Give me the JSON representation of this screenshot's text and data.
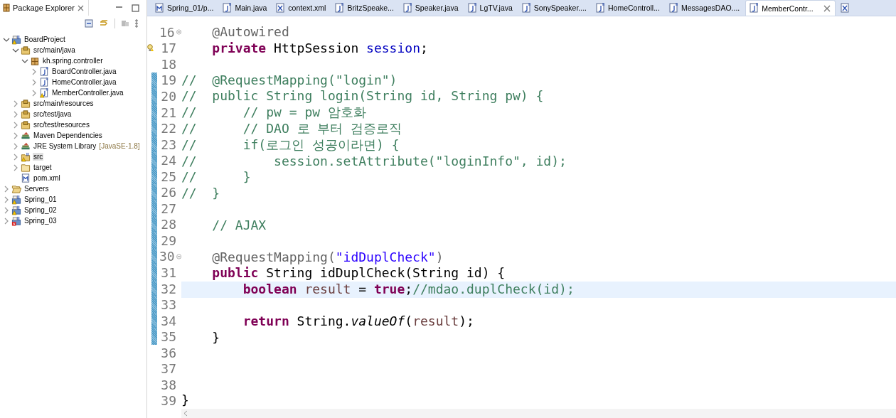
{
  "explorer": {
    "title": "Package Explorer",
    "tree": [
      {
        "label": "BoardProject",
        "kind": "project",
        "warning": true,
        "expanded": true,
        "selected": false,
        "children": [
          {
            "label": "src/main/java",
            "kind": "source-folder",
            "expanded": true,
            "selected": false,
            "children": [
              {
                "label": "kh.spring.controller",
                "kind": "package",
                "expanded": true,
                "selected": false,
                "children": [
                  {
                    "label": "BoardController.java",
                    "kind": "java",
                    "expanded": false,
                    "selected": false
                  },
                  {
                    "label": "HomeController.java",
                    "kind": "java",
                    "expanded": false,
                    "selected": false
                  },
                  {
                    "label": "MemberController.java",
                    "kind": "java",
                    "warning": true,
                    "expanded": false,
                    "selected": false
                  }
                ]
              }
            ]
          },
          {
            "label": "src/main/resources",
            "kind": "source-folder",
            "expanded": false,
            "selected": false
          },
          {
            "label": "src/test/java",
            "kind": "source-folder",
            "expanded": false,
            "selected": false
          },
          {
            "label": "src/test/resources",
            "kind": "source-folder",
            "expanded": false,
            "selected": false
          },
          {
            "label": "Maven Dependencies",
            "kind": "library",
            "expanded": false,
            "selected": false
          },
          {
            "label": "JRE System Library",
            "decoration": "[JavaSE-1.8]",
            "kind": "library",
            "expanded": false,
            "selected": false
          },
          {
            "label": "src",
            "kind": "folder-project",
            "warning": true,
            "expanded": false,
            "selected": true
          },
          {
            "label": "target",
            "kind": "folder",
            "expanded": false,
            "selected": false
          },
          {
            "label": "pom.xml",
            "kind": "maven",
            "selected": false
          }
        ]
      },
      {
        "label": "Servers",
        "kind": "folder-open",
        "expanded": false,
        "selected": false
      },
      {
        "label": "Spring_01",
        "kind": "project",
        "warning": true,
        "expanded": false,
        "selected": false
      },
      {
        "label": "Spring_02",
        "kind": "project",
        "warning": true,
        "expanded": false,
        "selected": false
      },
      {
        "label": "Spring_03",
        "kind": "project",
        "error": true,
        "expanded": false,
        "selected": false
      }
    ]
  },
  "editor": {
    "tabs": [
      {
        "label": "Spring_01/p...",
        "kind": "maven",
        "selected": false
      },
      {
        "label": "Main.java",
        "kind": "java",
        "selected": false
      },
      {
        "label": "context.xml",
        "kind": "xml",
        "selected": false
      },
      {
        "label": "BritzSpeake...",
        "kind": "java",
        "selected": false
      },
      {
        "label": "Speaker.java",
        "kind": "java",
        "selected": false
      },
      {
        "label": "LgTV.java",
        "kind": "java",
        "selected": false
      },
      {
        "label": "SonySpeaker....",
        "kind": "java",
        "selected": false
      },
      {
        "label": "HomeControll...",
        "kind": "java",
        "selected": false
      },
      {
        "label": "MessagesDAO....",
        "kind": "java",
        "selected": false
      },
      {
        "label": "MemberContr...",
        "kind": "java",
        "selected": true
      },
      {
        "kind": "xml",
        "selected": false
      }
    ],
    "lines": [
      {
        "n": "16",
        "changed": false,
        "current": false,
        "fold_open": true,
        "segments": [
          {
            "kind": "annotation",
            "text": "    @Autowired"
          }
        ]
      },
      {
        "n": "17",
        "changed": false,
        "current": false,
        "warning": true,
        "segments": [
          {
            "kind": "keyword",
            "text": "    private"
          },
          {
            "kind": "plain",
            "text": " HttpSession "
          },
          {
            "kind": "field",
            "text": "session"
          },
          {
            "kind": "plain",
            "text": ";"
          }
        ]
      },
      {
        "n": "18",
        "changed": false,
        "current": false
      },
      {
        "n": "19",
        "changed": true,
        "current": false,
        "segments": [
          {
            "kind": "comment",
            "text": "//  @RequestMapping(\"login\")"
          }
        ]
      },
      {
        "n": "20",
        "changed": true,
        "current": false,
        "segments": [
          {
            "kind": "comment",
            "text": "//  public String login(String id, String pw) {"
          }
        ]
      },
      {
        "n": "21",
        "changed": true,
        "current": false,
        "segments": [
          {
            "kind": "comment",
            "text": "//      // pw = pw 암호화"
          }
        ]
      },
      {
        "n": "22",
        "changed": true,
        "current": false,
        "segments": [
          {
            "kind": "comment",
            "text": "//      // DAO 로 부터 검증로직"
          }
        ]
      },
      {
        "n": "23",
        "changed": true,
        "current": false,
        "segments": [
          {
            "kind": "comment",
            "text": "//      if(로그인 성공이라면) {"
          }
        ]
      },
      {
        "n": "24",
        "changed": true,
        "current": false,
        "segments": [
          {
            "kind": "comment",
            "text": "//          session.setAttribute(\"loginInfo\", id);"
          }
        ]
      },
      {
        "n": "25",
        "changed": true,
        "current": false,
        "segments": [
          {
            "kind": "comment",
            "text": "//      }"
          }
        ]
      },
      {
        "n": "26",
        "changed": true,
        "current": false,
        "segments": [
          {
            "kind": "comment",
            "text": "//  }"
          }
        ]
      },
      {
        "n": "27",
        "changed": true,
        "current": false
      },
      {
        "n": "28",
        "changed": true,
        "current": false,
        "segments": [
          {
            "kind": "comment",
            "text": "    // AJAX"
          }
        ]
      },
      {
        "n": "29",
        "changed": true,
        "current": false
      },
      {
        "n": "30",
        "changed": true,
        "current": false,
        "fold_open": true,
        "segments": [
          {
            "kind": "annotation",
            "text": "    @RequestMapping("
          },
          {
            "kind": "string",
            "text": "\"idDuplCheck\""
          },
          {
            "kind": "annotation",
            "text": ")"
          }
        ]
      },
      {
        "n": "31",
        "changed": true,
        "current": false,
        "segments": [
          {
            "kind": "keyword",
            "text": "    public"
          },
          {
            "kind": "plain",
            "text": " String idDuplCheck(String id) {"
          }
        ]
      },
      {
        "n": "32",
        "changed": true,
        "current": true,
        "segments": [
          {
            "kind": "keyword",
            "text": "        boolean"
          },
          {
            "kind": "local",
            "text": " result"
          },
          {
            "kind": "plain",
            "text": " = "
          },
          {
            "kind": "keyword",
            "text": "true"
          },
          {
            "kind": "plain",
            "text": ";"
          },
          {
            "kind": "comment",
            "text": "//mdao.duplCheck(id);"
          }
        ]
      },
      {
        "n": "33",
        "changed": true,
        "current": false
      },
      {
        "n": "34",
        "changed": true,
        "current": false,
        "segments": [
          {
            "kind": "keyword",
            "text": "        return"
          },
          {
            "kind": "plain",
            "text": " String."
          },
          {
            "kind": "static",
            "text": "valueOf"
          },
          {
            "kind": "plain",
            "text": "("
          },
          {
            "kind": "local",
            "text": "result"
          },
          {
            "kind": "plain",
            "text": ");"
          }
        ]
      },
      {
        "n": "35",
        "changed": true,
        "current": false,
        "segments": [
          {
            "kind": "plain",
            "text": "    }"
          }
        ]
      },
      {
        "n": "36",
        "changed": false,
        "current": false
      },
      {
        "n": "37",
        "changed": false,
        "current": false
      },
      {
        "n": "38",
        "changed": false,
        "current": false
      },
      {
        "n": "39",
        "changed": false,
        "current": false,
        "segments": [
          {
            "kind": "plain",
            "text": "}"
          }
        ]
      }
    ]
  }
}
